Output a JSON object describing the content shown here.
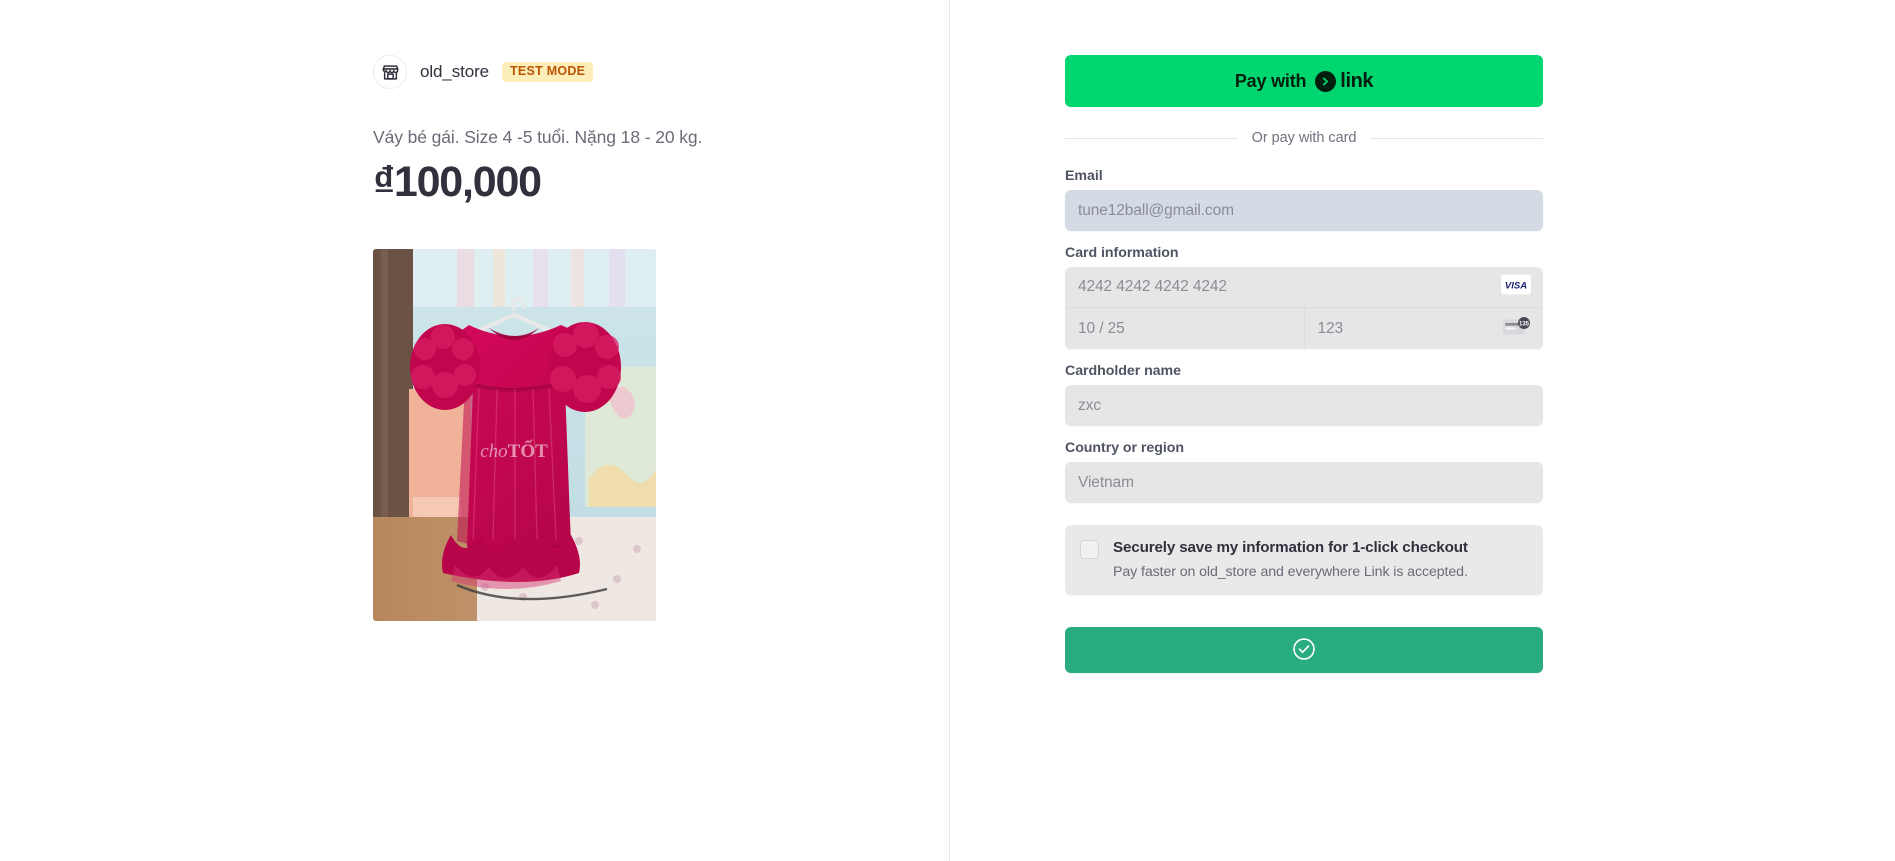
{
  "merchant": {
    "name": "old_store",
    "badge": "TEST MODE",
    "icon": "storefront-icon"
  },
  "product": {
    "description": "Váy bé gái. Size 4 -5 tuổi. Nặng 18 - 20 kg.",
    "price": "₫100,000",
    "image_alt": "Crimson tulle girls dress on hanger",
    "image_watermark": "choTỐT"
  },
  "express": {
    "pay_with_label": "Pay with",
    "link_wordmark": "link",
    "link_icon": "link-chevron-icon",
    "button_color": "#00d66f"
  },
  "divider": {
    "label": "Or pay with card"
  },
  "form": {
    "email": {
      "label": "Email",
      "value": "tune12ball@gmail.com"
    },
    "card": {
      "label": "Card information",
      "number": "4242 4242 4242 4242",
      "expiry": "10 / 25",
      "cvc": "123",
      "brand_icon": "visa-icon",
      "brand_label": "VISA",
      "cvc_icon": "cvc-card-icon",
      "cvc_icon_digits": "135"
    },
    "cardholder": {
      "label": "Cardholder name",
      "value": "zxc"
    },
    "country": {
      "label": "Country or region",
      "value": "Vietnam"
    }
  },
  "save_info": {
    "title": "Securely save my information for 1-click checkout",
    "subtitle": "Pay faster on old_store and everywhere Link is accepted.",
    "checked": false,
    "checkbox_icon": "checkbox-unchecked-icon"
  },
  "submit": {
    "label": "",
    "state_icon": "circle-check-icon",
    "button_color": "#29ac7f"
  }
}
